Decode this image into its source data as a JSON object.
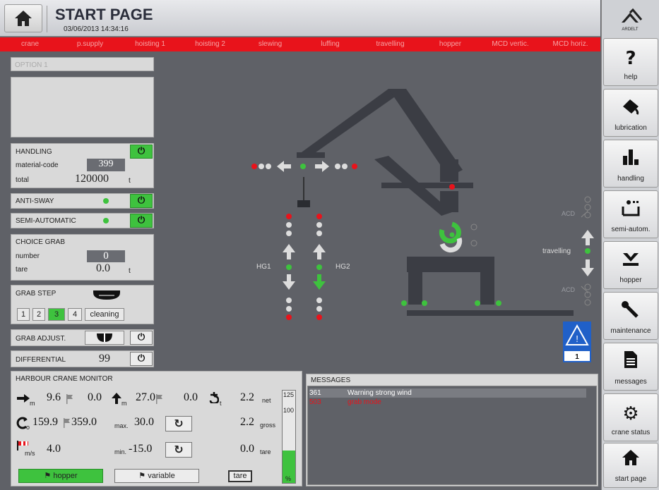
{
  "header": {
    "title": "START PAGE",
    "datetime": "03/06/2013 14:34:16",
    "brand": "ARDELT"
  },
  "tabs": [
    "crane",
    "p.supply",
    "hoisting 1",
    "hoisting 2",
    "slewing",
    "luffing",
    "travelling",
    "hopper",
    "MCD vertic.",
    "MCD horiz."
  ],
  "sidebar": [
    {
      "label": "help",
      "icon": "help-icon"
    },
    {
      "label": "lubrication",
      "icon": "oil-can-icon"
    },
    {
      "label": "handling",
      "icon": "bar-chart-icon"
    },
    {
      "label": "semi-autom.",
      "icon": "semi-auto-icon"
    },
    {
      "label": "hopper",
      "icon": "hopper-icon"
    },
    {
      "label": "maintenance",
      "icon": "wrench-icon"
    },
    {
      "label": "messages",
      "icon": "document-icon"
    },
    {
      "label": "crane status",
      "icon": "gear-info-icon"
    },
    {
      "label": "start page",
      "icon": "home-icon"
    }
  ],
  "option": {
    "label": "OPTION 1"
  },
  "handling": {
    "title": "HANDLING",
    "material_label": "material-code",
    "material_value": "399",
    "total_label": "total",
    "total_value": "120000",
    "total_unit": "t"
  },
  "anti_sway": {
    "label": "ANTI-SWAY"
  },
  "semi_automatic": {
    "label": "SEMI-AUTOMATIC"
  },
  "choice_grab": {
    "title": "CHOICE GRAB",
    "number_label": "number",
    "number_value": "0",
    "tare_label": "tare",
    "tare_value": "0.0",
    "tare_unit": "t"
  },
  "grab_step": {
    "title": "GRAB STEP",
    "steps": [
      "1",
      "2",
      "3",
      "4",
      "cleaning"
    ],
    "active": "3"
  },
  "grab_adjust": {
    "label": "GRAB ADJUST."
  },
  "differential": {
    "label": "DIFFERENTIAL",
    "value": "99"
  },
  "crane": {
    "hg1": "HG1",
    "hg2": "HG2",
    "travelling": "travelling",
    "acd_top": "ACD",
    "acd_bottom": "ACD",
    "warning_count": "1"
  },
  "monitor": {
    "title": "HARBOUR CRANE MONITOR",
    "outreach_unit": "m",
    "outreach": "9.6",
    "outreach_set": "0.0",
    "height_unit": "m",
    "height": "27.0",
    "height_set": "0.0",
    "load_unit": "t",
    "load_net": "2.2",
    "net_label": "net",
    "slew_unit": "o",
    "slew": "159.9",
    "slew_set": "359.0",
    "max_label": "max.",
    "max_value": "30.0",
    "gross_value": "2.2",
    "gross_label": "gross",
    "wind_unit": "m/s",
    "wind": "4.0",
    "min_label": "min.",
    "min_value": "-15.0",
    "tare_value": "0.0",
    "tare_label": "tare",
    "hopper_btn": "hopper",
    "variable_btn": "variable",
    "tare_btn": "tare",
    "scale_125": "125",
    "scale_100": "100",
    "scale_pct": "%",
    "bar_fraction": 0.35
  },
  "messages": {
    "title": "MESSAGES",
    "rows": [
      {
        "code": "361",
        "text": "Warning strong wind",
        "color": "#ffffff"
      },
      {
        "code": "503",
        "text": "grab mode",
        "color": "#e8131b"
      }
    ]
  },
  "colors": {
    "tab_red": "#e8131b",
    "on_green": "#3ec23e",
    "background": "#5f6167"
  }
}
